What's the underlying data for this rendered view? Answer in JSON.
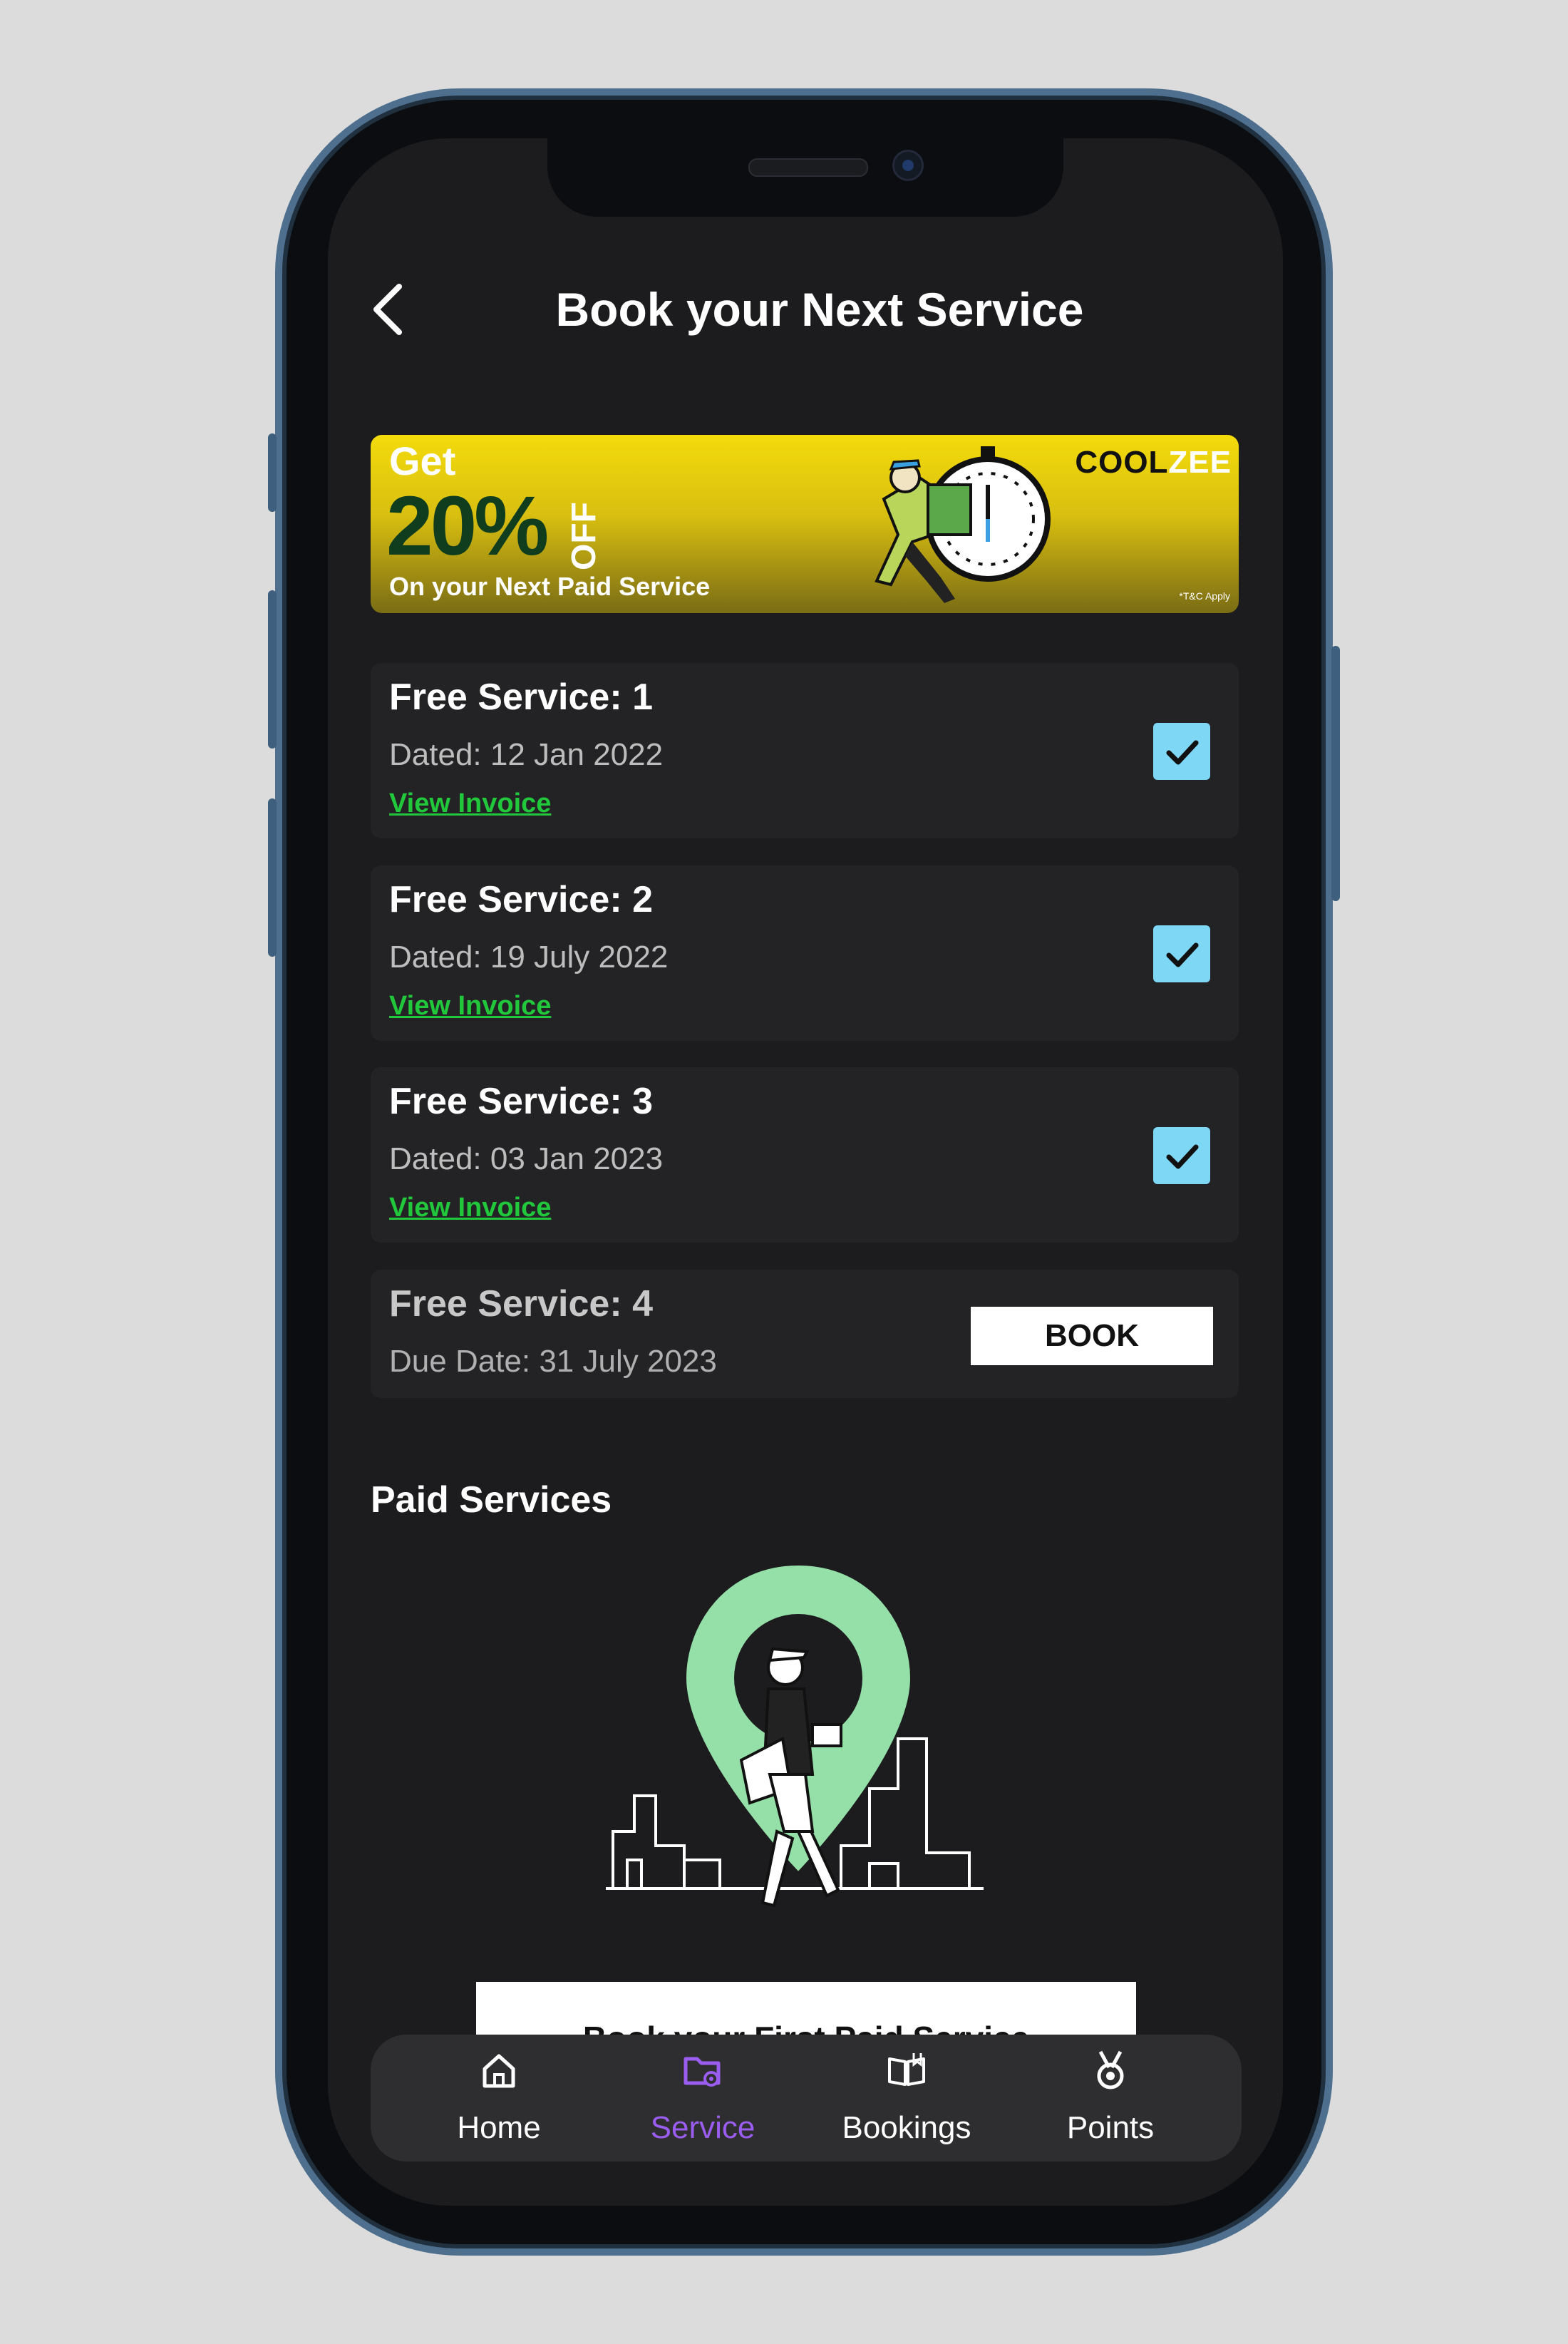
{
  "header": {
    "title": "Book your Next Service"
  },
  "banner": {
    "get": "Get",
    "percent": "20%",
    "off": "OFF",
    "subtitle": "On your Next Paid Service",
    "brand_a": "COOL",
    "brand_b": "ZEE",
    "terms": "*T&C Apply"
  },
  "services": [
    {
      "title": "Free Service: 1",
      "date": "Dated: 12 Jan 2022",
      "link": "View Invoice",
      "completed": true
    },
    {
      "title": "Free Service: 2",
      "date": "Dated: 19 July 2022",
      "link": "View Invoice",
      "completed": true
    },
    {
      "title": "Free Service: 3",
      "date": "Dated: 03 Jan 2023",
      "link": "View Invoice",
      "completed": true
    },
    {
      "title": "Free Service: 4",
      "date": "Due Date: 31 July 2023",
      "button": "BOOK",
      "completed": false
    }
  ],
  "paid": {
    "title": "Paid Services",
    "cta": "Book your First Paid Service"
  },
  "tabs": [
    {
      "label": "Home",
      "icon": "home-icon"
    },
    {
      "label": "Service",
      "icon": "folder-gear-icon",
      "active": true
    },
    {
      "label": "Bookings",
      "icon": "book-open-icon"
    },
    {
      "label": "Points",
      "icon": "medal-icon"
    }
  ],
  "colors": {
    "background": "#1c1c1e",
    "card": "#232325",
    "accent_link": "#22c83b",
    "check": "#7dd7f5",
    "tab_active": "#9b5cf0"
  }
}
